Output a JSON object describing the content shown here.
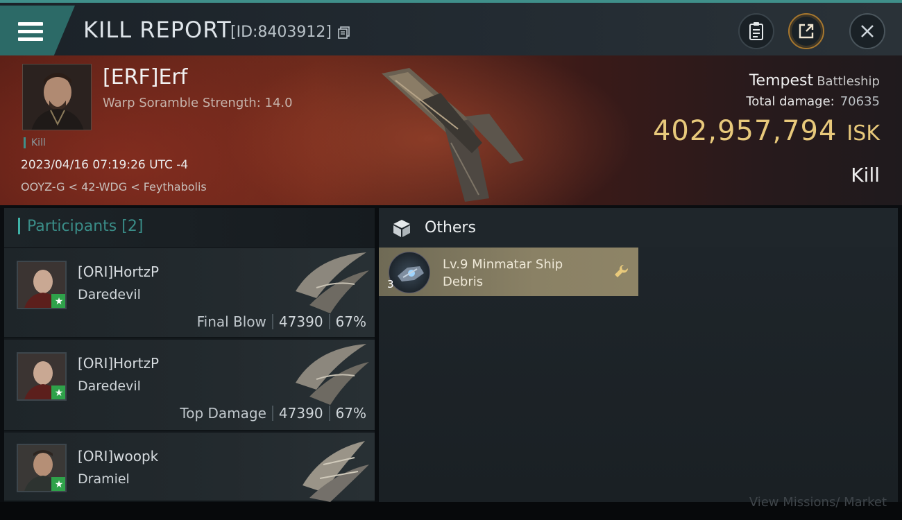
{
  "header": {
    "title": "KILL REPORT",
    "report_id": "[ID:8403912]"
  },
  "victim": {
    "name": "[ERF]Erf",
    "subtitle": "Warp Soramble Strength: 14.0",
    "tag": "Kill",
    "timestamp": "2023/04/16 07:19:26 UTC -4",
    "location": "OOYZ-G < 42-WDG < Feythabolis"
  },
  "ship": {
    "name": "Tempest",
    "class": "Battleship",
    "damage_label": "Total damage:",
    "damage_value": "70635",
    "isk_value": "402,957,794",
    "isk_unit": "ISK",
    "result": "Kill"
  },
  "participants": {
    "label": "Participants",
    "count": "[2]",
    "rows": [
      {
        "name": "[ORI]HortzP",
        "ship": "Daredevil",
        "role": "Final Blow",
        "damage": "47390",
        "percent": "67%"
      },
      {
        "name": "[ORI]HortzP",
        "ship": "Daredevil",
        "role": "Top Damage",
        "damage": "47390",
        "percent": "67%"
      },
      {
        "name": "[ORI]woopk",
        "ship": "Dramiel",
        "role": "",
        "damage": "",
        "percent": ""
      }
    ]
  },
  "others": {
    "title": "Others",
    "items": [
      {
        "name": "Lv.9 Minmatar Ship Debris",
        "qty": "3"
      }
    ]
  },
  "footer": {
    "text": "View Missions/ Market"
  },
  "colors": {
    "accent_teal": "#3f8f8a",
    "isk_gold": "#e8c97b",
    "item_card": "#8a8165",
    "commander_star": "#2fa24a"
  },
  "icons": [
    "menu-icon",
    "copy-icon",
    "clipboard-icon",
    "share-icon",
    "close-icon",
    "box-icon",
    "wrench-icon",
    "star-icon"
  ]
}
